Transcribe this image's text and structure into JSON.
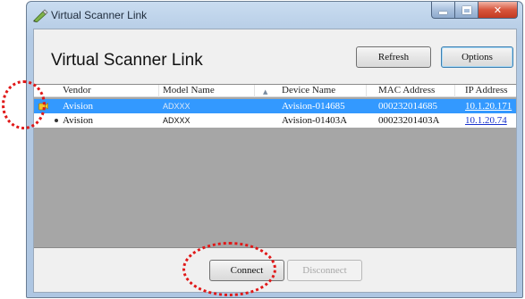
{
  "window": {
    "title": "Virtual Scanner Link",
    "icons": {
      "app": "scanner-pen-icon",
      "minimize": "minimize-icon",
      "maximize": "maximize-icon",
      "close": "close-icon"
    },
    "close_glyph": "✕"
  },
  "heading": "Virtual Scanner Link",
  "toolbar": {
    "refresh_label": "Refresh",
    "options_label": "Options"
  },
  "table": {
    "columns": [
      "Vendor",
      "Model Name",
      "Device Name",
      "MAC Address",
      "IP Address"
    ],
    "sort_column": "Device Name",
    "sort_glyph": "▲",
    "rows": [
      {
        "vendor": "Avision",
        "model": "ADXXX",
        "device": "Avision-014685",
        "mac": "000232014685",
        "ip": "10.1.20.171",
        "selected": true,
        "icon": "connected-device-icon"
      },
      {
        "vendor": "Avision",
        "model": "ADXXX",
        "device": "Avision-01403A",
        "mac": "00023201403A",
        "ip": "10.1.20.74",
        "selected": false,
        "icon": "bullet-dot-icon"
      }
    ]
  },
  "actions": {
    "connect_label": "Connect",
    "disconnect_label": "Disconnect",
    "disconnect_enabled": false
  },
  "colors": {
    "selection": "#3399ff",
    "link": "#1a33cc",
    "annotation": "#e01818",
    "list_background": "#a6a6a6",
    "close_button": "#d8553c"
  }
}
